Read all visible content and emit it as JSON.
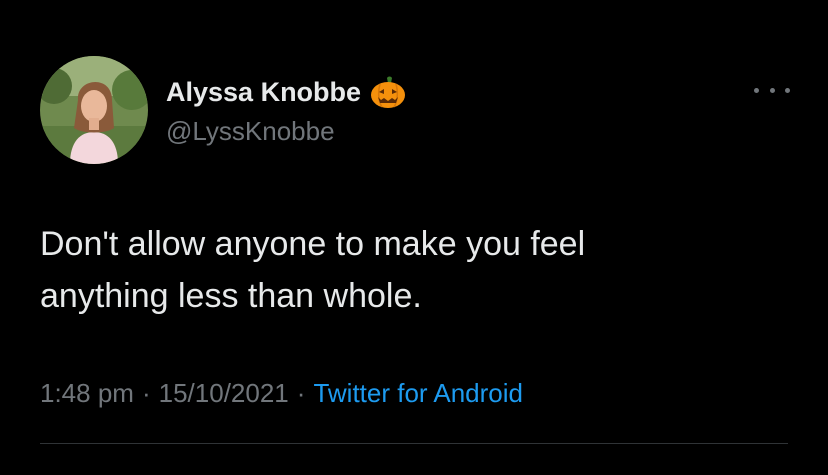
{
  "tweet": {
    "author": {
      "display_name": "Alyssa Knobbe",
      "handle": "@LyssKnobbe",
      "name_emoji": "jack-o-lantern-emoji"
    },
    "text": "Don't allow anyone to make you feel\nanything less than whole.",
    "time": "1:48 pm",
    "date": "15/10/2021",
    "separator": "·",
    "source": "Twitter for Android",
    "more_icon": "more-options-icon"
  },
  "colors": {
    "background": "#000000",
    "text_primary": "#e7e9ea",
    "text_secondary": "#71767b",
    "link": "#1d9bf0",
    "divider": "#2f3336",
    "pumpkin": "#f4900c"
  }
}
